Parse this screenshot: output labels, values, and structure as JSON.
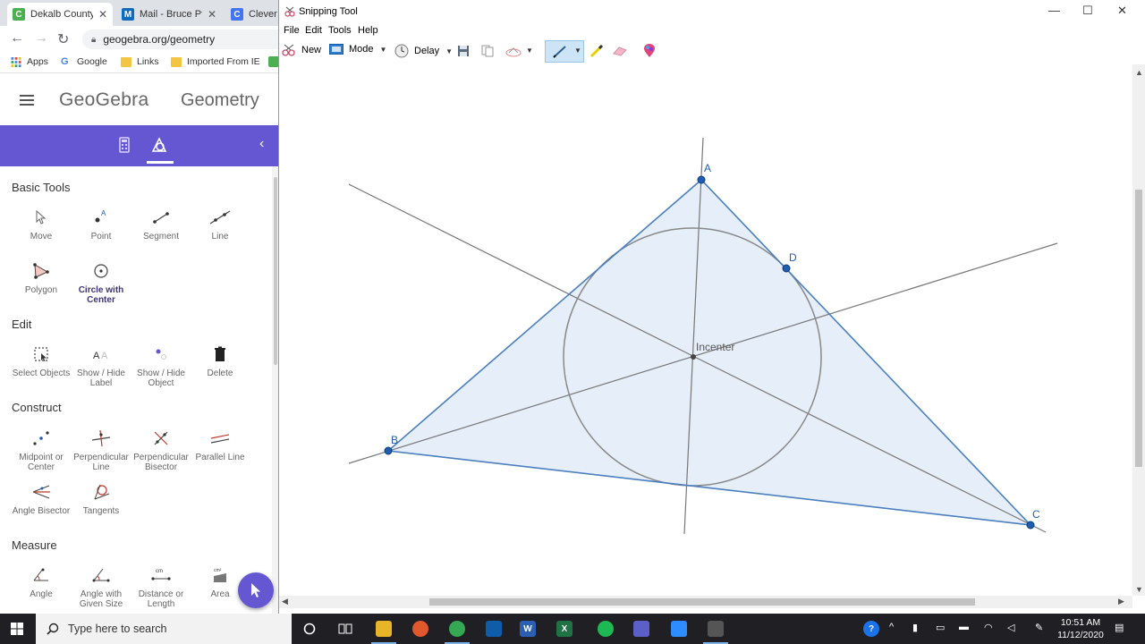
{
  "browser": {
    "tabs": [
      {
        "label": "Dekalb County",
        "icon": "C",
        "color": "#4caf50"
      },
      {
        "label": "Mail - Bruce Pf",
        "icon": "M",
        "color": "#0f6cbd"
      },
      {
        "label": "Clever |",
        "icon": "C",
        "color": "#4274f6"
      }
    ],
    "url": "geogebra.org/geometry",
    "bookmarks": [
      "Apps",
      "Google",
      "Links",
      "Imported From IE"
    ]
  },
  "geogebra": {
    "logo": "GeoGebra",
    "app_name": "Geometry",
    "sections": {
      "basic": "Basic Tools",
      "edit": "Edit",
      "construct": "Construct",
      "measure": "Measure"
    },
    "tools": {
      "move": "Move",
      "point": "Point",
      "segment": "Segment",
      "line": "Line",
      "polygon": "Polygon",
      "circle_center": "Circle with Center",
      "select_objects": "Select Objects",
      "show_hide_label": "Show / Hide Label",
      "show_hide_object": "Show / Hide Object",
      "delete": "Delete",
      "midpoint": "Midpoint or Center",
      "perpendicular": "Perpendicular Line",
      "perp_bisector": "Perpendicular Bisector",
      "parallel": "Parallel Line",
      "angle_bisector": "Angle Bisector",
      "tangents": "Tangents",
      "angle": "Angle",
      "angle_given": "Angle with Given Size",
      "distance": "Distance or Length",
      "area": "Area"
    },
    "area_icon_text": "cm²",
    "distance_icon_text": "cm"
  },
  "snipping": {
    "title": "Snipping Tool",
    "menu": [
      "File",
      "Edit",
      "Tools",
      "Help"
    ],
    "toolbar": {
      "new": "New",
      "mode": "Mode",
      "delay": "Delay"
    },
    "labels": {
      "A": "A",
      "B": "B",
      "C": "C",
      "D": "D",
      "incenter": "Incenter"
    }
  },
  "taskbar": {
    "search_placeholder": "Type here to search",
    "time": "10:51 AM",
    "date": "11/12/2020"
  },
  "colors": {
    "geogebra_purple": "#6557d2",
    "triangle_stroke": "#4a7fc0",
    "triangle_fill": "#e5eef9",
    "point_fill": "#1e5db0"
  }
}
